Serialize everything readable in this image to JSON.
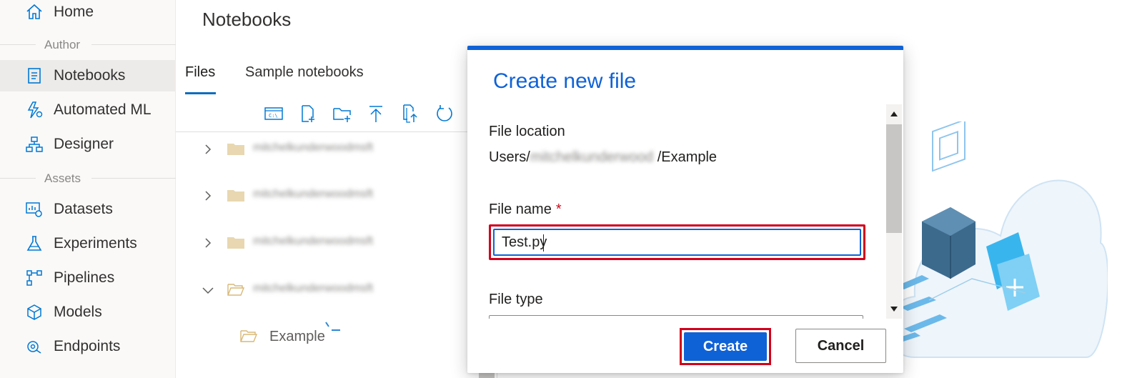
{
  "sidebar": {
    "home_label": "Home",
    "author_section": "Author",
    "notebooks_label": "Notebooks",
    "automated_ml_label": "Automated ML",
    "designer_label": "Designer",
    "assets_section": "Assets",
    "datasets_label": "Datasets",
    "experiments_label": "Experiments",
    "pipelines_label": "Pipelines",
    "models_label": "Models",
    "endpoints_label": "Endpoints"
  },
  "main": {
    "title": "Notebooks",
    "tabs": [
      {
        "label": "Files"
      },
      {
        "label": "Sample notebooks"
      }
    ],
    "tree": {
      "blurred_user": "mitchelkunderwoodmsft",
      "example_label": "Example"
    }
  },
  "modal": {
    "title": "Create new file",
    "file_location_label": "File location",
    "file_location_prefix": "Users/",
    "file_location_blurred": "mitchelkunderwood",
    "file_location_suffix": "/Example",
    "file_name_label": "File name",
    "required_marker": "*",
    "file_name_value": "Test.py",
    "file_type_label": "File type",
    "create_label": "Create",
    "cancel_label": "Cancel"
  },
  "colors": {
    "accent": "#0f62d6",
    "highlight": "#d1001c",
    "required": "#c50f1f"
  }
}
